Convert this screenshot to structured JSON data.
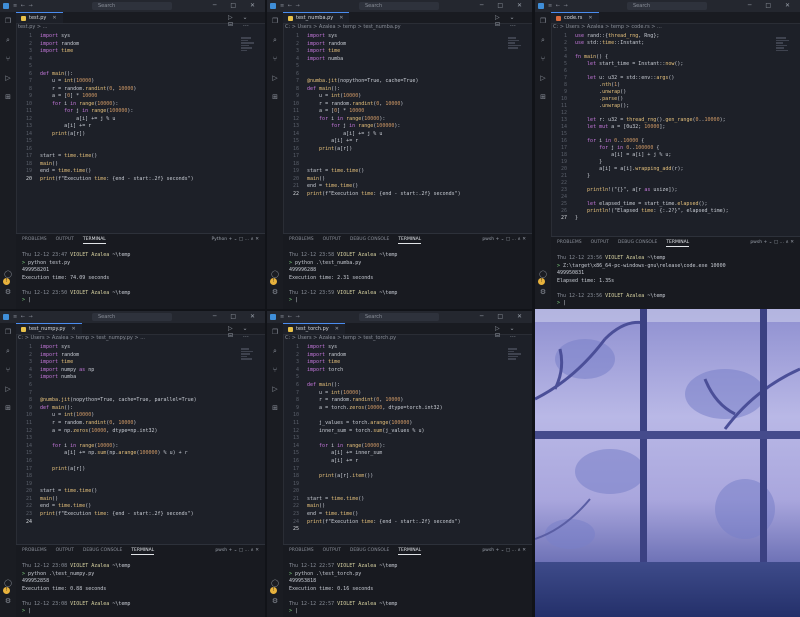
{
  "search_label": "Search",
  "panel_tabs": [
    "PROBLEMS",
    "OUTPUT",
    "DEBUG CONSOLE",
    "TERMINAL"
  ],
  "panes": [
    {
      "tab": "test.py",
      "breadcrumb": "test.py > ...",
      "code": [
        {
          "n": "1",
          "t": "import sys"
        },
        {
          "n": "2",
          "t": "import random"
        },
        {
          "n": "3",
          "t": "import time"
        },
        {
          "n": "4",
          "t": ""
        },
        {
          "n": "5",
          "t": ""
        },
        {
          "n": "6",
          "t": "def main():"
        },
        {
          "n": "7",
          "t": "    u = int(10000)"
        },
        {
          "n": "8",
          "t": "    r = random.randint(0, 10000)"
        },
        {
          "n": "9",
          "t": "    a = [0] * 10000"
        },
        {
          "n": "10",
          "t": "    for i in range(10000):"
        },
        {
          "n": "11",
          "t": "        for j in range(100000):"
        },
        {
          "n": "12",
          "t": "            a[i] += j % u"
        },
        {
          "n": "13",
          "t": "        a[i] += r"
        },
        {
          "n": "14",
          "t": "    print(a[r])"
        },
        {
          "n": "15",
          "t": ""
        },
        {
          "n": "16",
          "t": ""
        },
        {
          "n": "17",
          "t": "start = time.time()"
        },
        {
          "n": "18",
          "t": "main()"
        },
        {
          "n": "19",
          "t": "end = time.time()"
        },
        {
          "n": "20",
          "t": "print(f\"Execution time: {end - start:.2f} seconds\")"
        }
      ],
      "panel_tools": "Python  +  ⌄  □  …  ∧  ✕",
      "terminal": [
        "Thu 12-12 23:47 VIOLET Azalea ~\\temp",
        "> python test.py",
        "499958201",
        "Execution time: 74.09 seconds",
        "",
        "Thu 12-12 23:50 VIOLET Azalea ~\\temp",
        "> |"
      ]
    },
    {
      "tab": "test_numba.py",
      "breadcrumb": "C: > Users > Azalea > temp > test_numba.py",
      "code": [
        {
          "n": "1",
          "t": "import sys"
        },
        {
          "n": "2",
          "t": "import random"
        },
        {
          "n": "3",
          "t": "import time"
        },
        {
          "n": "4",
          "t": "import numba"
        },
        {
          "n": "5",
          "t": ""
        },
        {
          "n": "6",
          "t": ""
        },
        {
          "n": "7",
          "t": "@numba.jit(nopython=True, cache=True)"
        },
        {
          "n": "8",
          "t": "def main():"
        },
        {
          "n": "9",
          "t": "    u = int(10000)"
        },
        {
          "n": "10",
          "t": "    r = random.randint(0, 10000)"
        },
        {
          "n": "11",
          "t": "    a = [0] * 10000"
        },
        {
          "n": "12",
          "t": "    for i in range(10000):"
        },
        {
          "n": "13",
          "t": "        for j in range(100000):"
        },
        {
          "n": "14",
          "t": "            a[i] += j % u"
        },
        {
          "n": "15",
          "t": "        a[i] += r"
        },
        {
          "n": "16",
          "t": "    print(a[r])"
        },
        {
          "n": "17",
          "t": ""
        },
        {
          "n": "18",
          "t": ""
        },
        {
          "n": "19",
          "t": "start = time.time()"
        },
        {
          "n": "20",
          "t": "main()"
        },
        {
          "n": "21",
          "t": "end = time.time()"
        },
        {
          "n": "22",
          "t": "print(f\"Execution time: {end - start:.2f} seconds\")"
        }
      ],
      "panel_tools": "pwsh  +  ⌄  □  …  ∧  ✕",
      "terminal": [
        "Thu 12-12 23:58 VIOLET Azalea ~\\temp",
        "> python .\\test_numba.py",
        "499996288",
        "Execution time: 2.31 seconds",
        "",
        "Thu 12-12 23:59 VIOLET Azalea ~\\temp",
        "> |"
      ]
    },
    {
      "tab": "code.rs",
      "breadcrumb": "C: > Users > Azalea > temp > code.rs > ...",
      "code": [
        {
          "n": "1",
          "t": "use rand::{thread_rng, Rng};"
        },
        {
          "n": "2",
          "t": "use std::time::Instant;"
        },
        {
          "n": "3",
          "t": ""
        },
        {
          "n": "4",
          "t": "fn main() {"
        },
        {
          "n": "5",
          "t": "    let start_time = Instant::now();"
        },
        {
          "n": "6",
          "t": ""
        },
        {
          "n": "7",
          "t": "    let u: u32 = std::env::args()"
        },
        {
          "n": "8",
          "t": "        .nth(1)"
        },
        {
          "n": "9",
          "t": "        .unwrap()"
        },
        {
          "n": "10",
          "t": "        .parse()"
        },
        {
          "n": "11",
          "t": "        .unwrap();"
        },
        {
          "n": "12",
          "t": ""
        },
        {
          "n": "13",
          "t": "    let r: u32 = thread_rng().gen_range(0..10000);"
        },
        {
          "n": "14",
          "t": "    let mut a = [0u32; 10000];"
        },
        {
          "n": "15",
          "t": ""
        },
        {
          "n": "16",
          "t": "    for i in 0..10000 {"
        },
        {
          "n": "17",
          "t": "        for j in 0..100000 {"
        },
        {
          "n": "18",
          "t": "            a[i] = a[i] + j % u;"
        },
        {
          "n": "19",
          "t": "        }"
        },
        {
          "n": "20",
          "t": "        a[i] = a[i].wrapping_add(r);"
        },
        {
          "n": "21",
          "t": "    }"
        },
        {
          "n": "22",
          "t": ""
        },
        {
          "n": "23",
          "t": "    println!(\"{}\", a[r as usize]);"
        },
        {
          "n": "24",
          "t": ""
        },
        {
          "n": "25",
          "t": "    let elapsed_time = start_time.elapsed();"
        },
        {
          "n": "26",
          "t": "    println!(\"Elapsed time: {:.2?}\", elapsed_time);"
        },
        {
          "n": "27",
          "t": "}"
        }
      ],
      "panel_tools": "pwsh  +  ⌄  □  …  ∧  ✕",
      "terminal": [
        "Thu 12-12 23:56 VIOLET Azalea ~\\temp",
        "> Z:\\target\\x86_64-pc-windows-gnu\\release\\code.exe 10000",
        "499950831",
        "Elapsed time: 1.35s",
        "",
        "Thu 12-12 23:56 VIOLET Azalea ~\\temp",
        "> |"
      ]
    },
    {
      "tab": "test_numpy.py",
      "breadcrumb": "C: > Users > Azalea > temp > test_numpy.py > ...",
      "code": [
        {
          "n": "1",
          "t": "import sys"
        },
        {
          "n": "2",
          "t": "import random"
        },
        {
          "n": "3",
          "t": "import time"
        },
        {
          "n": "4",
          "t": "import numpy as np"
        },
        {
          "n": "5",
          "t": "import numba"
        },
        {
          "n": "6",
          "t": ""
        },
        {
          "n": "7",
          "t": ""
        },
        {
          "n": "8",
          "t": "@numba.jit(nopython=True, cache=True, parallel=True)"
        },
        {
          "n": "9",
          "t": "def main():"
        },
        {
          "n": "10",
          "t": "    u = int(10000)"
        },
        {
          "n": "11",
          "t": "    r = random.randint(0, 10000)"
        },
        {
          "n": "12",
          "t": "    a = np.zeros(10000, dtype=np.int32)"
        },
        {
          "n": "13",
          "t": ""
        },
        {
          "n": "14",
          "t": "    for i in range(10000):"
        },
        {
          "n": "15",
          "t": "        a[i] += np.sum(np.arange(100000) % u) + r"
        },
        {
          "n": "16",
          "t": ""
        },
        {
          "n": "17",
          "t": "    print(a[r])"
        },
        {
          "n": "18",
          "t": ""
        },
        {
          "n": "19",
          "t": ""
        },
        {
          "n": "20",
          "t": "start = time.time()"
        },
        {
          "n": "21",
          "t": "main()"
        },
        {
          "n": "22",
          "t": "end = time.time()"
        },
        {
          "n": "23",
          "t": "print(f\"Execution time: {end - start:.2f} seconds\")"
        },
        {
          "n": "24",
          "t": ""
        }
      ],
      "panel_tools": "pwsh  +  ⌄  □  …  ∧  ✕",
      "terminal": [
        "Thu 12-12 23:08 VIOLET Azalea ~\\temp",
        "> python .\\test_numpy.py",
        "499952858",
        "Execution time: 0.88 seconds",
        "",
        "Thu 12-12 23:08 VIOLET Azalea ~\\temp",
        "> |"
      ]
    },
    {
      "tab": "test_torch.py",
      "breadcrumb": "C: > Users > Azalea > temp > test_torch.py",
      "code": [
        {
          "n": "1",
          "t": "import sys"
        },
        {
          "n": "2",
          "t": "import random"
        },
        {
          "n": "3",
          "t": "import time"
        },
        {
          "n": "4",
          "t": "import torch"
        },
        {
          "n": "5",
          "t": ""
        },
        {
          "n": "6",
          "t": "def main():"
        },
        {
          "n": "7",
          "t": "    u = int(10000)"
        },
        {
          "n": "8",
          "t": "    r = random.randint(0, 10000)"
        },
        {
          "n": "9",
          "t": "    a = torch.zeros(10000, dtype=torch.int32)"
        },
        {
          "n": "10",
          "t": ""
        },
        {
          "n": "11",
          "t": "    j_values = torch.arange(100000)"
        },
        {
          "n": "12",
          "t": "    inner_sum = torch.sum(j_values % u)"
        },
        {
          "n": "13",
          "t": ""
        },
        {
          "n": "14",
          "t": "    for i in range(10000):"
        },
        {
          "n": "15",
          "t": "        a[i] += inner_sum"
        },
        {
          "n": "16",
          "t": "        a[i] += r"
        },
        {
          "n": "17",
          "t": ""
        },
        {
          "n": "18",
          "t": "    print(a[r].item())"
        },
        {
          "n": "19",
          "t": ""
        },
        {
          "n": "20",
          "t": ""
        },
        {
          "n": "21",
          "t": "start = time.time()"
        },
        {
          "n": "22",
          "t": "main()"
        },
        {
          "n": "23",
          "t": "end = time.time()"
        },
        {
          "n": "24",
          "t": "print(f\"Execution time: {end - start:.2f} seconds\")"
        },
        {
          "n": "25",
          "t": ""
        }
      ],
      "panel_tools": "pwsh  +  ⌄  □  …  ∧  ✕",
      "terminal": [
        "Thu 12-12 22:57 VIOLET Azalea ~\\temp",
        "> python .\\test_torch.py",
        "499953818",
        "Execution time: 0.16 seconds",
        "",
        "Thu 12-12 22:57 VIOLET Azalea ~\\temp",
        "> |"
      ]
    }
  ]
}
